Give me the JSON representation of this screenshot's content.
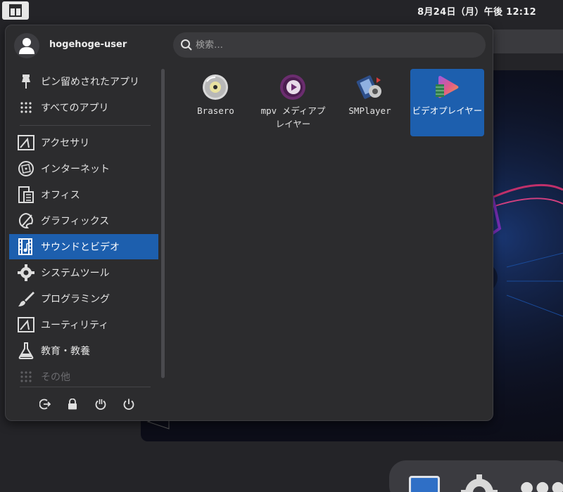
{
  "topbar": {
    "clock": "8月24日（月）午後 12:12",
    "launcher_icon": "app-menu-icon"
  },
  "menu": {
    "user": {
      "name": "hogehoge-user",
      "icon": "user-icon"
    },
    "search": {
      "placeholder": "検索…",
      "value": "",
      "icon": "search-icon"
    },
    "pinned": [
      {
        "label": "ピン留めされたアプリ",
        "icon": "pin-icon"
      },
      {
        "label": "すべてのアプリ",
        "icon": "grid-icon"
      }
    ],
    "categories": [
      {
        "label": "アクセサリ",
        "icon": "accessories-icon"
      },
      {
        "label": "インターネット",
        "icon": "internet-icon"
      },
      {
        "label": "オフィス",
        "icon": "office-icon"
      },
      {
        "label": "グラフィックス",
        "icon": "graphics-icon"
      },
      {
        "label": "サウンドとビデオ",
        "icon": "sound-video-icon",
        "selected": true
      },
      {
        "label": "システムツール",
        "icon": "system-tools-icon"
      },
      {
        "label": "プログラミング",
        "icon": "programming-icon"
      },
      {
        "label": "ユーティリティ",
        "icon": "utilities-icon"
      },
      {
        "label": "教育・教養",
        "icon": "education-icon"
      },
      {
        "label": "その他",
        "icon": "other-icon",
        "disabled": true
      }
    ],
    "power": [
      {
        "name": "logout-icon"
      },
      {
        "name": "lock-icon"
      },
      {
        "name": "suspend-icon"
      },
      {
        "name": "power-icon"
      }
    ],
    "apps": [
      {
        "label": "Brasero",
        "icon": "brasero-icon"
      },
      {
        "label": "mpv メディアプレイヤー",
        "icon": "mpv-icon"
      },
      {
        "label": "SMPlayer",
        "icon": "smplayer-icon"
      },
      {
        "label": "ビデオプレイヤー",
        "icon": "video-player-icon",
        "selected": true
      }
    ]
  },
  "colors": {
    "selection": "#1d5fae",
    "panel": "#2c2c2e",
    "desktop": "#242428"
  }
}
